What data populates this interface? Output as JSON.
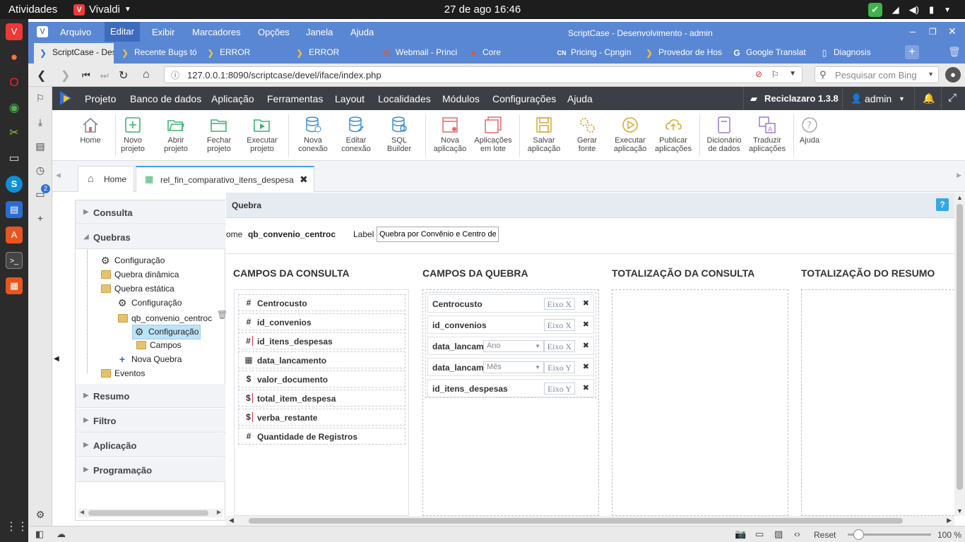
{
  "os": {
    "activities": "Atividades",
    "app_name": "Vivaldi",
    "clock": "27 de ago  16:46"
  },
  "menubar": {
    "items": [
      "Arquivo",
      "Editar",
      "Exibir",
      "Marcadores",
      "Opções",
      "Janela",
      "Ajuda"
    ],
    "selected": "Editar",
    "window_title": "ScriptCase - Desenvolvimento - admin"
  },
  "tabs": [
    {
      "label": "ScriptCase - Desenv",
      "icon": "scriptcase-icon",
      "active": true
    },
    {
      "label": "Recente Bugs tó",
      "icon": "scriptcase-icon",
      "active": false
    },
    {
      "label": "ERROR",
      "icon": "scriptcase-icon",
      "active": false
    },
    {
      "label": "ERROR",
      "icon": "scriptcase-icon",
      "active": false
    },
    {
      "label": "Webmail - Princi",
      "icon": "webmail-icon",
      "active": false
    },
    {
      "label": "Core",
      "icon": "core-icon",
      "active": false
    },
    {
      "label": "Pricing - Cpngin",
      "icon": "cn-icon",
      "active": false
    },
    {
      "label": "Provedor de Hos",
      "icon": "scriptcase-icon",
      "active": false
    },
    {
      "label": "Google Translat",
      "icon": "google-icon",
      "active": false
    },
    {
      "label": "Diagnosis",
      "icon": "document-icon",
      "active": false
    }
  ],
  "address": {
    "url": "127.0.0.1:8090/scriptcase/devel/iface/index.php",
    "search_placeholder": "Pesquisar com Bing"
  },
  "scriptcase": {
    "menu": [
      "Projeto",
      "Banco de dados",
      "Aplicação",
      "Ferramentas",
      "Layout",
      "Localidades",
      "Módulos",
      "Configurações",
      "Ajuda"
    ],
    "project": "Reciclazaro 1.3.8",
    "user": "admin"
  },
  "toolbar": [
    {
      "label": "Home",
      "icon": "home-icon"
    },
    {
      "label": "Novo\nprojeto",
      "icon": "new-project-icon"
    },
    {
      "label": "Abrir\nprojeto",
      "icon": "open-folder-icon"
    },
    {
      "label": "Fechar\nprojeto",
      "icon": "close-folder-icon"
    },
    {
      "label": "Executar\nprojeto",
      "icon": "run-project-icon"
    },
    {
      "label": "Nova\nconexão",
      "icon": "new-connection-icon"
    },
    {
      "label": "Editar\nconexão",
      "icon": "edit-connection-icon"
    },
    {
      "label": "SQL\nBuilder",
      "icon": "sql-builder-icon"
    },
    {
      "label": "Nova\naplicação",
      "icon": "new-app-icon"
    },
    {
      "label": "Aplicações\nem lote",
      "icon": "batch-apps-icon"
    },
    {
      "label": "Salvar\naplicação",
      "icon": "save-icon"
    },
    {
      "label": "Gerar\nfonte",
      "icon": "generate-source-icon"
    },
    {
      "label": "Executar\naplicação",
      "icon": "run-app-icon"
    },
    {
      "label": "Publicar\naplicações",
      "icon": "publish-icon"
    },
    {
      "label": "Dicionário\nde dados",
      "icon": "dictionary-icon"
    },
    {
      "label": "Traduzir\naplicações",
      "icon": "translate-icon"
    },
    {
      "label": "Ajuda",
      "icon": "help-icon"
    }
  ],
  "app_tabs": {
    "home": "Home",
    "app": "rel_fin_comparativo_itens_despesa"
  },
  "tree": {
    "sections": [
      "Consulta",
      "Quebras",
      "Resumo",
      "Filtro",
      "Aplicação",
      "Programação"
    ],
    "quebras_items": [
      "Configuração",
      "Quebra dinâmica",
      "Quebra estática",
      "Configuração",
      "qb_convenio_centroc",
      "Configuração",
      "Campos",
      "Nova Quebra",
      "Eventos"
    ]
  },
  "main": {
    "title": "Quebra",
    "name_label": "ome",
    "name_value": "qb_convenio_centroc",
    "label_label": "Label",
    "label_value": "Quebra por Convênio e Centro de",
    "columns": [
      "CAMPOS DA CONSULTA",
      "CAMPOS DA QUEBRA",
      "TOTALIZAÇÃO DA CONSULTA",
      "TOTALIZAÇÃO DO RESUMO"
    ],
    "consulta_fields": [
      {
        "symbol": "#",
        "name": "Centrocusto"
      },
      {
        "symbol": "#",
        "name": "id_convenios"
      },
      {
        "symbol": "#",
        "name": "id_itens_despesas"
      },
      {
        "symbol": "▦",
        "name": "data_lancamento"
      },
      {
        "symbol": "$",
        "name": "valor_documento"
      },
      {
        "symbol": "$",
        "name": "total_item_despesa"
      },
      {
        "symbol": "$",
        "name": "verba_restante"
      },
      {
        "symbol": "#",
        "name": "Quantidade de Registros"
      }
    ],
    "quebra_fields": [
      {
        "name": "Centrocusto",
        "select": "",
        "axis": "Eixo X"
      },
      {
        "name": "id_convenios",
        "select": "",
        "axis": "Eixo X"
      },
      {
        "name": "data_lancam",
        "select": "Ano",
        "axis": "Eixo X"
      },
      {
        "name": "data_lancam",
        "select": "Mês",
        "axis": "Eixo Y"
      },
      {
        "name": "id_itens_despesas",
        "select": "",
        "axis": "Eixo Y"
      }
    ]
  },
  "status": {
    "reset": "Reset",
    "zoom": "100 %"
  },
  "colors": {
    "menubar": "#5a87d4",
    "sc_header": "#3c3f45",
    "accent": "#35a7e4"
  }
}
